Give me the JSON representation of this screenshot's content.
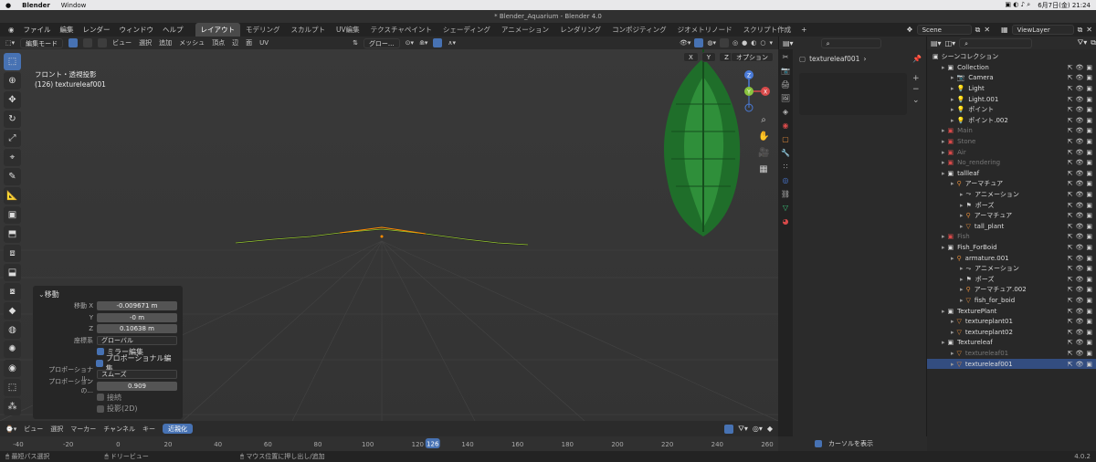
{
  "macbar": {
    "apple": "",
    "app": "Blender",
    "window": "Window",
    "datetime": "6月7日(金) 21:24"
  },
  "window_title": "* Blender_Aquarium - Blender 4.0",
  "menus": [
    "ファイル",
    "編集",
    "レンダー",
    "ウィンドウ",
    "ヘルプ"
  ],
  "workspaces": [
    "レイアウト",
    "モデリング",
    "スカルプト",
    "UV編集",
    "テクスチャペイント",
    "シェーディング",
    "アニメーション",
    "レンダリング",
    "コンポジティング",
    "ジオメトリノード",
    "スクリプト作成"
  ],
  "active_workspace": 0,
  "scene": "Scene",
  "viewlayer": "ViewLayer",
  "viewport_header": {
    "mode": "編集モード",
    "menus": [
      "ビュー",
      "選択",
      "追加",
      "メッシュ",
      "頂点",
      "辺",
      "面",
      "UV"
    ],
    "transform_orientation": "グロー...",
    "options": "オプション"
  },
  "viewport_info": {
    "line1": "フロント・透視投影",
    "line2": "(126) textureleaf001"
  },
  "gizmo": {
    "x": "X",
    "y": "Y",
    "z": "Z"
  },
  "view_axes": [
    "X",
    "Y",
    "Z"
  ],
  "operator_panel": {
    "title": "移動",
    "move_x_label": "移動 X",
    "move_x": "-0.009671 m",
    "y_label": "Y",
    "y": "-0 m",
    "z_label": "Z",
    "z": "0.10638 m",
    "orient_label": "座標系",
    "orient": "グローバル",
    "mirror": "ミラー編集",
    "prop_edit": "プロポーショナル編集",
    "prop_falloff_label": "プロポーショナル...",
    "prop_falloff": "スムーズ",
    "prop_size_label": "プロポーションの...",
    "prop_size": "0.909",
    "connected": "接続",
    "projected": "投影(2D)"
  },
  "props": {
    "object_name": "textureleaf001"
  },
  "outliner": {
    "root": "シーンコレクション",
    "rows": [
      {
        "label": "Collection",
        "indent": 1,
        "icon": "collection"
      },
      {
        "label": "Camera",
        "indent": 2,
        "icon": "camera"
      },
      {
        "label": "Light",
        "indent": 2,
        "icon": "light"
      },
      {
        "label": "Light.001",
        "indent": 2,
        "icon": "light"
      },
      {
        "label": "ポイント",
        "indent": 2,
        "icon": "light"
      },
      {
        "label": "ポイント.002",
        "indent": 2,
        "icon": "light"
      },
      {
        "label": "Main",
        "indent": 1,
        "icon": "collection-dim",
        "dim": true
      },
      {
        "label": "Stone",
        "indent": 1,
        "icon": "collection-dim",
        "dim": true
      },
      {
        "label": "Air",
        "indent": 1,
        "icon": "collection-dim",
        "dim": true
      },
      {
        "label": "No_rendering",
        "indent": 1,
        "icon": "collection-dim",
        "dim": true
      },
      {
        "label": "tallleaf",
        "indent": 1,
        "icon": "collection"
      },
      {
        "label": "アーマチュア",
        "indent": 2,
        "icon": "armature"
      },
      {
        "label": "アニメーション",
        "indent": 3,
        "icon": "anim"
      },
      {
        "label": "ポーズ",
        "indent": 3,
        "icon": "pose"
      },
      {
        "label": "アーマチュア",
        "indent": 3,
        "icon": "armature"
      },
      {
        "label": "tall_plant",
        "indent": 3,
        "icon": "mesh"
      },
      {
        "label": "Fish",
        "indent": 1,
        "icon": "collection-dim",
        "dim": true
      },
      {
        "label": "Fish_ForBoid",
        "indent": 1,
        "icon": "collection"
      },
      {
        "label": "armature.001",
        "indent": 2,
        "icon": "armature"
      },
      {
        "label": "アニメーション",
        "indent": 3,
        "icon": "anim"
      },
      {
        "label": "ポーズ",
        "indent": 3,
        "icon": "pose"
      },
      {
        "label": "アーマチュア.002",
        "indent": 3,
        "icon": "armature"
      },
      {
        "label": "fish_for_boid",
        "indent": 3,
        "icon": "mesh"
      },
      {
        "label": "TexturePlant",
        "indent": 1,
        "icon": "collection"
      },
      {
        "label": "textureplant01",
        "indent": 2,
        "icon": "mesh"
      },
      {
        "label": "textureplant02",
        "indent": 2,
        "icon": "mesh"
      },
      {
        "label": "Textureleaf",
        "indent": 1,
        "icon": "collection"
      },
      {
        "label": "textureleaf01",
        "indent": 2,
        "icon": "mesh",
        "dim": true
      },
      {
        "label": "textureleaf001",
        "indent": 2,
        "icon": "mesh",
        "selected": true
      }
    ]
  },
  "timeline_header": {
    "menus": [
      "ビュー",
      "選択",
      "マーカー",
      "チャンネル",
      "キー"
    ],
    "snap": "近親化"
  },
  "timeline": {
    "ticks": [
      "-40",
      "-20",
      "0",
      "20",
      "40",
      "60",
      "80",
      "100",
      "120",
      "140",
      "160",
      "180",
      "200",
      "220",
      "240",
      "260"
    ],
    "current": "126"
  },
  "timeline_right": {
    "show_cursor": "カーソルを表示"
  },
  "status": {
    "left": "最短パス選択",
    "middle": "ドリービュー",
    "right": "マウス位置に押し出し/追加",
    "version": "4.0.2"
  },
  "colors": {
    "accent": "#4772b3",
    "selected_row": "#334d80",
    "viewport": "#393939"
  }
}
